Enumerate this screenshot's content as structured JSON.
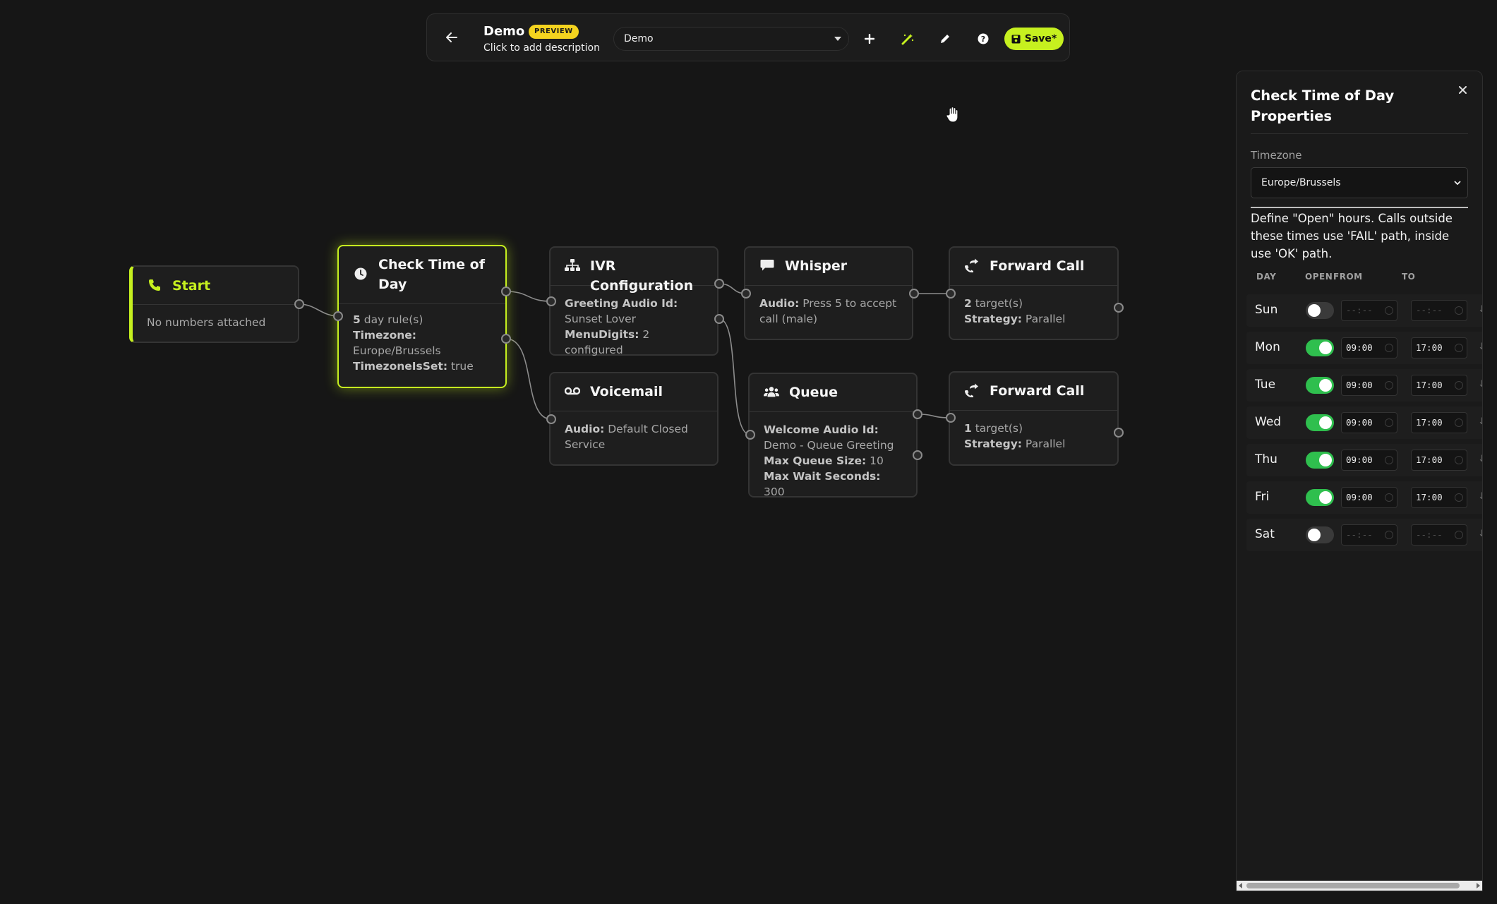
{
  "toolbar": {
    "flow_name": "Demo",
    "badge": "PREVIEW",
    "description": "Click to add description",
    "selected_flow": "Demo",
    "save_label": "Save*",
    "accent": "#c6f01f"
  },
  "nodes": {
    "start": {
      "title": "Start",
      "body": "No numbers attached"
    },
    "check_time": {
      "title": "Check Time of Day",
      "rules_count": "5",
      "rules_suffix": " day rule(s)",
      "timezone_label": "Timezone:",
      "timezone_value": "Europe/Brussels",
      "tzset_label": "TimezoneIsSet:",
      "tzset_value": " true"
    },
    "ivr": {
      "title": "IVR Configuration",
      "greeting_label": "Greeting Audio Id:",
      "greeting_value": " Sunset Lover",
      "menu_label": "MenuDigits:",
      "menu_value": " 2 configured"
    },
    "whisper": {
      "title": "Whisper",
      "audio_label": "Audio:",
      "audio_value": " Press 5 to accept call (male)"
    },
    "forward1": {
      "title": "Forward Call",
      "targets_count": "2",
      "targets_suffix": " target(s)",
      "strategy_label": "Strategy:",
      "strategy_value": " Parallel"
    },
    "voicemail": {
      "title": "Voicemail",
      "audio_label": "Audio:",
      "audio_value": " Default Closed Service"
    },
    "queue": {
      "title": "Queue",
      "welcome_label": "Welcome Audio Id:",
      "welcome_value": " Demo - Queue Greeting",
      "max_size_label": "Max Queue Size:",
      "max_size_value": " 10",
      "max_wait_label": "Max Wait Seconds:",
      "max_wait_value": " 300"
    },
    "forward2": {
      "title": "Forward Call",
      "targets_count": "1",
      "targets_suffix": " target(s)",
      "strategy_label": "Strategy:",
      "strategy_value": " Parallel"
    }
  },
  "panel": {
    "title": "Check Time of Day Properties",
    "timezone_label": "Timezone",
    "timezone_value": "Europe/Brussels",
    "define_text": "Define \"Open\" hours. Calls outside these times use 'FAIL' path, inside use 'OK' path.",
    "columns": {
      "day": "DAY",
      "open": "OPEN",
      "from": "FROM",
      "to": "TO"
    },
    "days": [
      {
        "name": "Sun",
        "open": false,
        "from": "--:--",
        "to": "--:--"
      },
      {
        "name": "Mon",
        "open": true,
        "from": "09:00",
        "to": "17:00"
      },
      {
        "name": "Tue",
        "open": true,
        "from": "09:00",
        "to": "17:00"
      },
      {
        "name": "Wed",
        "open": true,
        "from": "09:00",
        "to": "17:00"
      },
      {
        "name": "Thu",
        "open": true,
        "from": "09:00",
        "to": "17:00"
      },
      {
        "name": "Fri",
        "open": true,
        "from": "09:00",
        "to": "17:00"
      },
      {
        "name": "Sat",
        "open": false,
        "from": "--:--",
        "to": "--:--"
      }
    ]
  }
}
